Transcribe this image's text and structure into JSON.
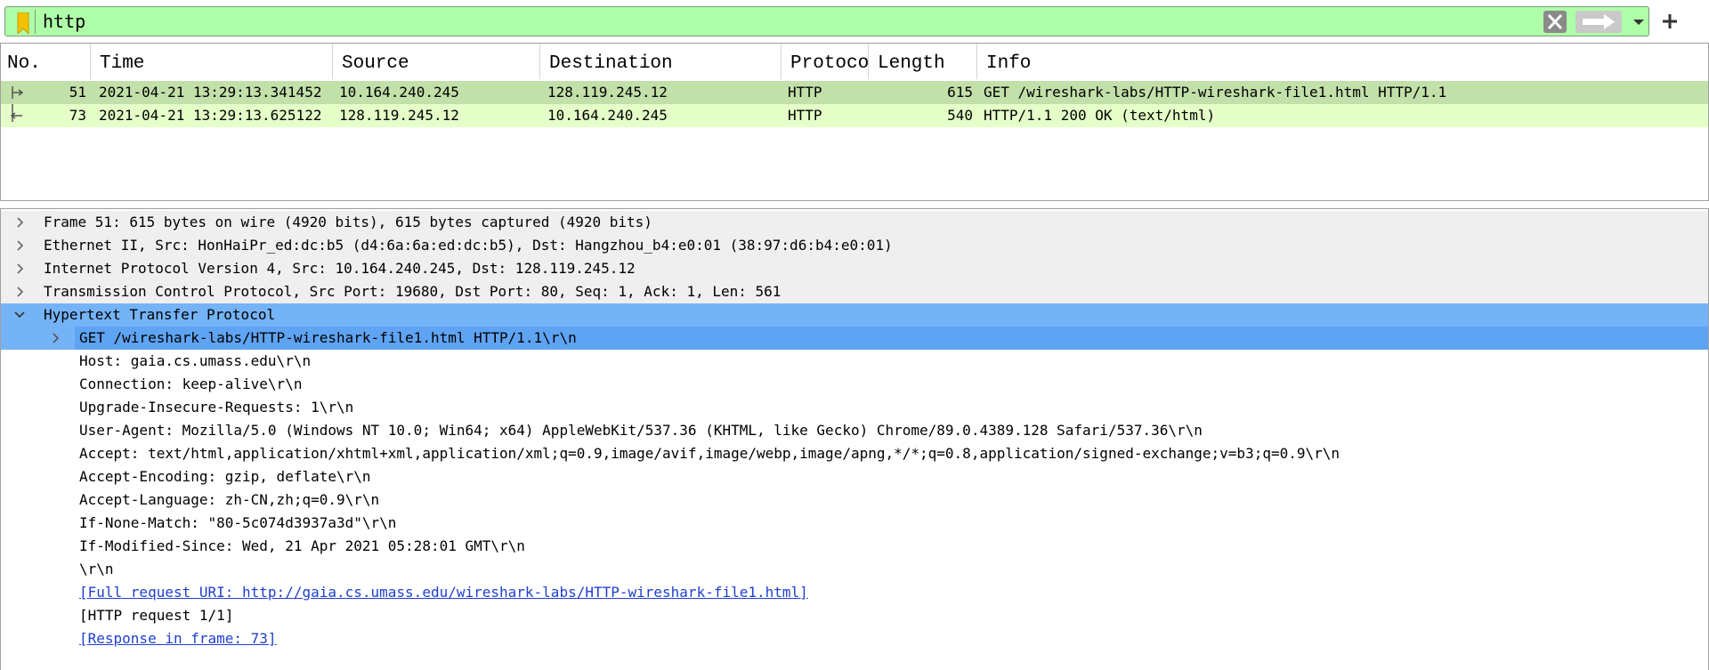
{
  "filter": {
    "value": "http"
  },
  "packet_list": {
    "columns": [
      "No.",
      "Time",
      "Source",
      "Destination",
      "Protoco",
      "Length",
      "Info"
    ],
    "rows": [
      {
        "no": "51",
        "time": "2021-04-21 13:29:13.341452",
        "source": "10.164.240.245",
        "destination": "128.119.245.12",
        "protocol": "HTTP",
        "length": "615",
        "info": "GET /wireshark-labs/HTTP-wireshark-file1.html HTTP/1.1"
      },
      {
        "no": "73",
        "time": "2021-04-21 13:29:13.625122",
        "source": "128.119.245.12",
        "destination": "10.164.240.245",
        "protocol": "HTTP",
        "length": "540",
        "info": "HTTP/1.1 200 OK  (text/html)"
      }
    ]
  },
  "details": {
    "lines": [
      "Frame 51: 615 bytes on wire (4920 bits), 615 bytes captured (4920 bits)",
      "Ethernet II, Src: HonHaiPr_ed:dc:b5 (d4:6a:6a:ed:dc:b5), Dst: Hangzhou_b4:e0:01 (38:97:d6:b4:e0:01)",
      "Internet Protocol Version 4, Src: 10.164.240.245, Dst: 128.119.245.12",
      "Transmission Control Protocol, Src Port: 19680, Dst Port: 80, Seq: 1, Ack: 1, Len: 561",
      "Hypertext Transfer Protocol",
      "GET /wireshark-labs/HTTP-wireshark-file1.html HTTP/1.1\\r\\n",
      "Host: gaia.cs.umass.edu\\r\\n",
      "Connection: keep-alive\\r\\n",
      "Upgrade-Insecure-Requests: 1\\r\\n",
      "User-Agent: Mozilla/5.0 (Windows NT 10.0; Win64; x64) AppleWebKit/537.36 (KHTML, like Gecko) Chrome/89.0.4389.128 Safari/537.36\\r\\n",
      "Accept: text/html,application/xhtml+xml,application/xml;q=0.9,image/avif,image/webp,image/apng,*/*;q=0.8,application/signed-exchange;v=b3;q=0.9\\r\\n",
      "Accept-Encoding: gzip, deflate\\r\\n",
      "Accept-Language: zh-CN,zh;q=0.9\\r\\n",
      "If-None-Match: \"80-5c074d3937a3d\"\\r\\n",
      "If-Modified-Since: Wed, 21 Apr 2021 05:28:01 GMT\\r\\n",
      "\\r\\n",
      "[Full request URI: http://gaia.cs.umass.edu/wireshark-labs/HTTP-wireshark-file1.html]",
      "[HTTP request 1/1]",
      "[Response in frame: 73]"
    ]
  },
  "colors": {
    "filter_bg": "#affea8",
    "selected_row": "#c2e0a9",
    "http_row": "#e4ffc7",
    "tree_highlight": "#75b3f7",
    "link": "#1f3fd0"
  }
}
